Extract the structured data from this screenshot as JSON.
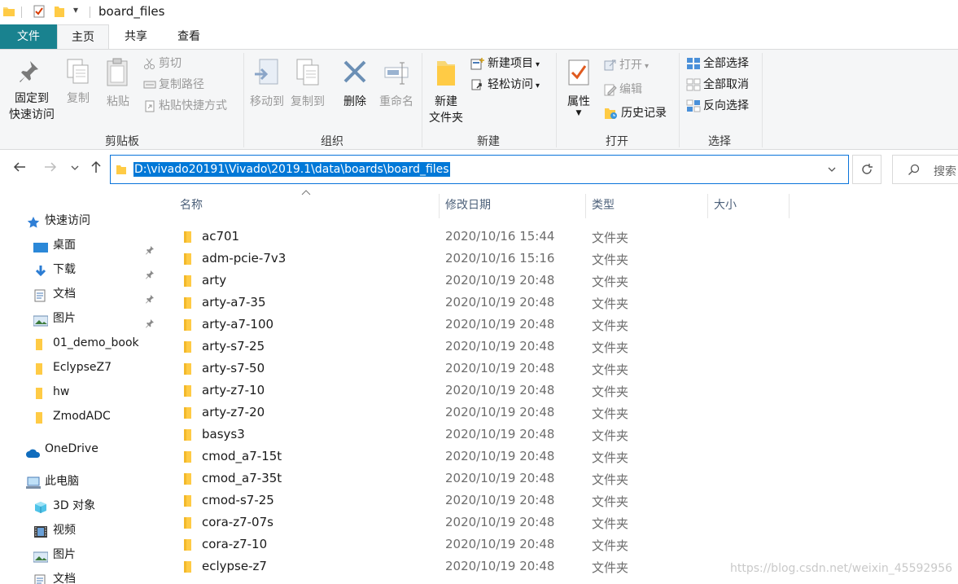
{
  "window": {
    "title": "board_files"
  },
  "ribbon": {
    "tabs": [
      {
        "label": "文件"
      },
      {
        "label": "主页"
      },
      {
        "label": "共享"
      },
      {
        "label": "查看"
      }
    ],
    "clipboard": {
      "label": "剪贴板",
      "pin_line1": "固定到",
      "pin_line2": "快速访问",
      "copy": "复制",
      "paste": "粘贴",
      "cut": "剪切",
      "copy_path": "复制路径",
      "paste_shortcut": "粘贴快捷方式"
    },
    "organize": {
      "label": "组织",
      "move_to": "移动到",
      "copy_to": "复制到",
      "delete": "删除",
      "rename": "重命名"
    },
    "new": {
      "label": "新建",
      "new_folder_line1": "新建",
      "new_folder_line2": "文件夹",
      "new_item": "新建项目",
      "easy_access": "轻松访问"
    },
    "open": {
      "label": "打开",
      "properties": "属性",
      "open": "打开",
      "edit": "编辑",
      "history": "历史记录"
    },
    "select": {
      "label": "选择",
      "select_all": "全部选择",
      "select_none": "全部取消",
      "invert": "反向选择"
    }
  },
  "address": {
    "path": "D:\\vivado20191\\Vivado\\2019.1\\data\\boards\\board_files",
    "search_placeholder": "搜索"
  },
  "nav": {
    "quick_access": "快速访问",
    "items": [
      {
        "label": "桌面"
      },
      {
        "label": "下载"
      },
      {
        "label": "文档"
      },
      {
        "label": "图片"
      },
      {
        "label": "01_demo_book"
      },
      {
        "label": "EclypseZ7"
      },
      {
        "label": "hw"
      },
      {
        "label": "ZmodADC"
      }
    ],
    "onedrive": "OneDrive",
    "this_pc": "此电脑",
    "pc_items": [
      {
        "label": "3D 对象"
      },
      {
        "label": "视频"
      },
      {
        "label": "图片"
      },
      {
        "label": "文档"
      }
    ]
  },
  "list": {
    "columns": {
      "name": "名称",
      "date": "修改日期",
      "type": "类型",
      "size": "大小"
    },
    "rows": [
      {
        "name": "ac701",
        "date": "2020/10/16 15:44",
        "type": "文件夹"
      },
      {
        "name": "adm-pcie-7v3",
        "date": "2020/10/16 15:16",
        "type": "文件夹"
      },
      {
        "name": "arty",
        "date": "2020/10/19 20:48",
        "type": "文件夹"
      },
      {
        "name": "arty-a7-35",
        "date": "2020/10/19 20:48",
        "type": "文件夹"
      },
      {
        "name": "arty-a7-100",
        "date": "2020/10/19 20:48",
        "type": "文件夹"
      },
      {
        "name": "arty-s7-25",
        "date": "2020/10/19 20:48",
        "type": "文件夹"
      },
      {
        "name": "arty-s7-50",
        "date": "2020/10/19 20:48",
        "type": "文件夹"
      },
      {
        "name": "arty-z7-10",
        "date": "2020/10/19 20:48",
        "type": "文件夹"
      },
      {
        "name": "arty-z7-20",
        "date": "2020/10/19 20:48",
        "type": "文件夹"
      },
      {
        "name": "basys3",
        "date": "2020/10/19 20:48",
        "type": "文件夹"
      },
      {
        "name": "cmod_a7-15t",
        "date": "2020/10/19 20:48",
        "type": "文件夹"
      },
      {
        "name": "cmod_a7-35t",
        "date": "2020/10/19 20:48",
        "type": "文件夹"
      },
      {
        "name": "cmod-s7-25",
        "date": "2020/10/19 20:48",
        "type": "文件夹"
      },
      {
        "name": "cora-z7-07s",
        "date": "2020/10/19 20:48",
        "type": "文件夹"
      },
      {
        "name": "cora-z7-10",
        "date": "2020/10/19 20:48",
        "type": "文件夹"
      },
      {
        "name": "eclypse-z7",
        "date": "2020/10/19 20:48",
        "type": "文件夹"
      }
    ]
  },
  "watermark": "https://blog.csdn.net/weixin_45592956"
}
